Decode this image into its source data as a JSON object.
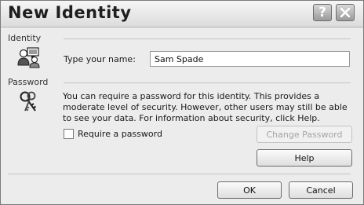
{
  "window": {
    "title": "New Identity",
    "help_glyph": "?",
    "close_glyph": "✕"
  },
  "identity": {
    "group_label": "Identity",
    "icon": "people-icon",
    "name_label": "Type your name:",
    "name_value": "Sam Spade"
  },
  "password": {
    "group_label": "Password",
    "icon": "keys-icon",
    "description": "You can require a password for this identity.  This provides a moderate level of security. However, other users may still be able to see your data. For information about security, click Help.",
    "require_label": "Require a password",
    "require_checked": false,
    "change_button": "Change Password"
  },
  "buttons": {
    "help": "Help",
    "ok": "OK",
    "cancel": "Cancel"
  }
}
